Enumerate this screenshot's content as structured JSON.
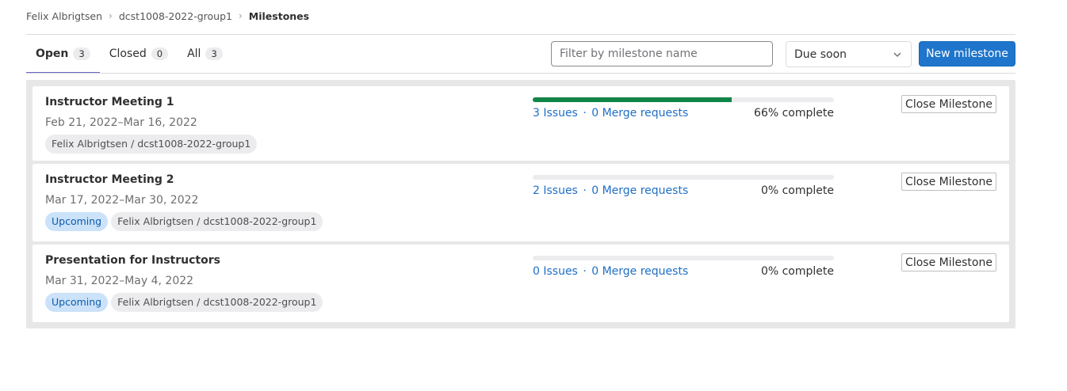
{
  "breadcrumb": {
    "items": [
      "Felix Albrigtsen",
      "dcst1008-2022-group1"
    ],
    "current": "Milestones"
  },
  "tabs": [
    {
      "label": "Open",
      "count": "3",
      "active": true
    },
    {
      "label": "Closed",
      "count": "0",
      "active": false
    },
    {
      "label": "All",
      "count": "3",
      "active": false
    }
  ],
  "filter": {
    "placeholder": "Filter by milestone name",
    "value": ""
  },
  "sort": {
    "selected": "Due soon"
  },
  "actions": {
    "new_milestone": "New milestone"
  },
  "milestones": [
    {
      "title": "Instructor Meeting 1",
      "dates": "Feb 21, 2022–Mar 16, 2022",
      "upcoming": null,
      "path": "Felix Albrigtsen / dcst1008-2022-group1",
      "issues": "3 Issues",
      "separator": "·",
      "merge_requests": "0 Merge requests",
      "complete": "66% complete",
      "progress": 0.66,
      "close_label": "Close Milestone"
    },
    {
      "title": "Instructor Meeting 2",
      "dates": "Mar 17, 2022–Mar 30, 2022",
      "upcoming": "Upcoming",
      "path": "Felix Albrigtsen / dcst1008-2022-group1",
      "issues": "2 Issues",
      "separator": "·",
      "merge_requests": "0 Merge requests",
      "complete": "0% complete",
      "progress": 0,
      "close_label": "Close Milestone"
    },
    {
      "title": "Presentation for Instructors",
      "dates": "Mar 31, 2022–May 4, 2022",
      "upcoming": "Upcoming",
      "path": "Felix Albrigtsen / dcst1008-2022-group1",
      "issues": "0 Issues",
      "separator": "·",
      "merge_requests": "0 Merge requests",
      "complete": "0% complete",
      "progress": 0,
      "close_label": "Close Milestone"
    }
  ],
  "colors": {
    "accent": "#1f75cb",
    "progress_fill": "#108548",
    "tab_underline": "#6666c4",
    "upcoming_bg": "#cbe2f9",
    "link": "#1f6fc6"
  },
  "icons": {
    "breadcrumb_separator": "chevron-right-icon",
    "sort_dropdown": "chevron-down-icon"
  }
}
